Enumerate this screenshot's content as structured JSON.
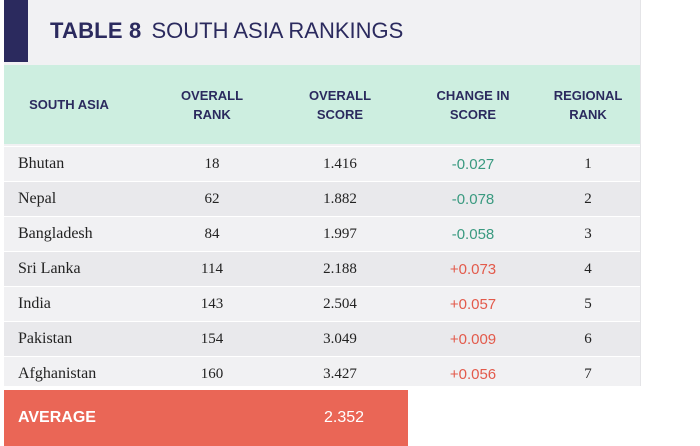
{
  "title": {
    "number": "TABLE 8",
    "text": "SOUTH ASIA RANKINGS"
  },
  "columns": [
    "SOUTH ASIA",
    "OVERALL\nRANK",
    "OVERALL\nSCORE",
    "CHANGE IN\nSCORE",
    "REGIONAL\nRANK"
  ],
  "rows": [
    {
      "country": "Bhutan",
      "rank": "18",
      "score": "1.416",
      "change": "-0.027",
      "regional": "1"
    },
    {
      "country": "Nepal",
      "rank": "62",
      "score": "1.882",
      "change": "-0.078",
      "regional": "2"
    },
    {
      "country": "Bangladesh",
      "rank": "84",
      "score": "1.997",
      "change": "-0.058",
      "regional": "3"
    },
    {
      "country": "Sri Lanka",
      "rank": "114",
      "score": "2.188",
      "change": "+0.073",
      "regional": "4"
    },
    {
      "country": "India",
      "rank": "143",
      "score": "2.504",
      "change": "+0.057",
      "regional": "5"
    },
    {
      "country": "Pakistan",
      "rank": "154",
      "score": "3.049",
      "change": "+0.009",
      "regional": "6"
    },
    {
      "country": "Afghanistan",
      "rank": "160",
      "score": "3.427",
      "change": "+0.056",
      "regional": "7"
    }
  ],
  "average": {
    "label": "AVERAGE",
    "value": "2.352"
  },
  "colors": {
    "navy": "#2b2a5e",
    "header_bg": "#cdeee0",
    "negative": "#3a9a80",
    "positive": "#e35a4b",
    "average_bg": "#ea6656"
  }
}
